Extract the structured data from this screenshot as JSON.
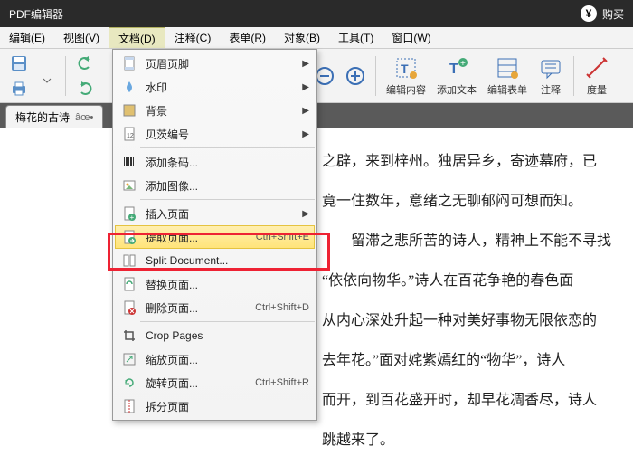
{
  "title": "PDF编辑器",
  "buy": "购买",
  "menubar": [
    "编辑(E)",
    "视图(V)",
    "文档(D)",
    "注释(C)",
    "表单(R)",
    "对象(B)",
    "工具(T)",
    "窗口(W)"
  ],
  "toolbar": {
    "edit_content": "编辑内容",
    "add_text": "添加文本",
    "edit_form": "编辑表单",
    "annotate": "注释",
    "measure": "度量"
  },
  "tab": {
    "label": "梅花的古诗"
  },
  "doc": {
    "p1": "之辟，来到梓州。独居异乡，寄迹幕府，已",
    "p2": "竟一住数年，意绪之无聊郁闷可想而知。",
    "p3": "　　留滞之悲所苦的诗人，精神上不能不寻找",
    "p4": "“依依向物华。”诗人在百花争艳的春色面",
    "p5": "从内心深处升起一种对美好事物无限依恋的",
    "p6": "去年花。”面对姹紫嫣红的“物华”，诗人",
    "p7": "而开，到百花盛开时，却早花凋香尽，诗人",
    "p8": "跳越来了。"
  },
  "menu": {
    "header_footer": "页眉页脚",
    "watermark": "水印",
    "background": "背景",
    "bates": "贝茨编号",
    "barcode": "添加条码...",
    "image": "添加图像...",
    "insert_page": "插入页面",
    "extract_page": "提取页面...",
    "extract_accel": "Ctrl+Shift+E",
    "split": "Split Document...",
    "replace_page": "替换页面...",
    "delete_page": "删除页面...",
    "delete_accel": "Ctrl+Shift+D",
    "crop": "Crop Pages",
    "resize": "缩放页面...",
    "rotate": "旋转页面...",
    "rotate_accel": "Ctrl+Shift+R",
    "split_page": "拆分页面"
  }
}
